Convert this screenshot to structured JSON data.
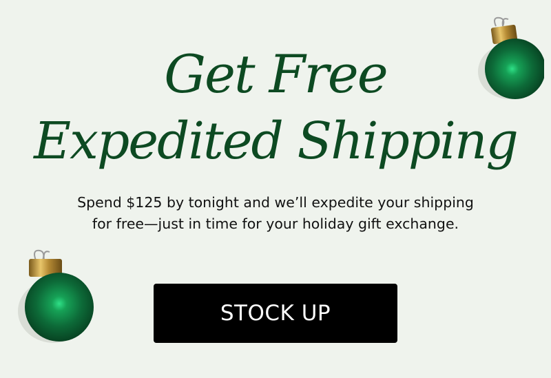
{
  "banner": {
    "headline_line_1": "Get Free",
    "headline_line_2": "Expedited Shipping",
    "subtext_line_1": "Spend $125 by tonight and we’ll expedite your shipping",
    "subtext_line_2": "for free—just in time for your holiday gift exchange.",
    "cta_label": "STOCK UP"
  },
  "colors": {
    "background": "#eff3ed",
    "headline": "#0d4a22",
    "cta_background": "#000000",
    "cta_text": "#ffffff",
    "ornament_green": "#0e6a3a",
    "ornament_cap": "#c9a54a"
  },
  "decorations": {
    "top_right": "christmas-ornament-icon",
    "bottom_left": "christmas-ornament-icon"
  }
}
